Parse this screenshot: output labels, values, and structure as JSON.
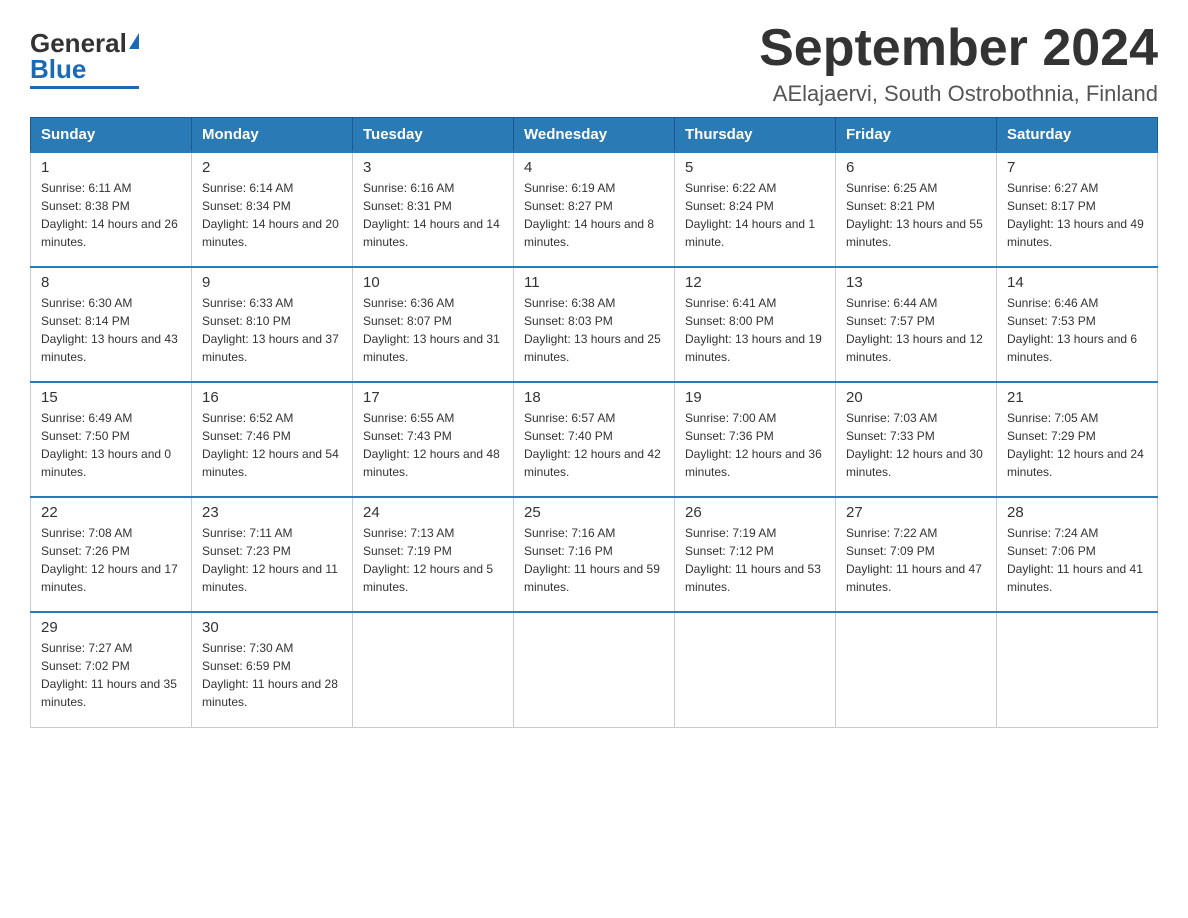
{
  "header": {
    "logo_general": "General",
    "logo_blue": "Blue",
    "month_title": "September 2024",
    "location": "AElajaervi, South Ostrobothnia, Finland"
  },
  "weekdays": [
    "Sunday",
    "Monday",
    "Tuesday",
    "Wednesday",
    "Thursday",
    "Friday",
    "Saturday"
  ],
  "weeks": [
    [
      {
        "day": "1",
        "sunrise": "Sunrise: 6:11 AM",
        "sunset": "Sunset: 8:38 PM",
        "daylight": "Daylight: 14 hours and 26 minutes."
      },
      {
        "day": "2",
        "sunrise": "Sunrise: 6:14 AM",
        "sunset": "Sunset: 8:34 PM",
        "daylight": "Daylight: 14 hours and 20 minutes."
      },
      {
        "day": "3",
        "sunrise": "Sunrise: 6:16 AM",
        "sunset": "Sunset: 8:31 PM",
        "daylight": "Daylight: 14 hours and 14 minutes."
      },
      {
        "day": "4",
        "sunrise": "Sunrise: 6:19 AM",
        "sunset": "Sunset: 8:27 PM",
        "daylight": "Daylight: 14 hours and 8 minutes."
      },
      {
        "day": "5",
        "sunrise": "Sunrise: 6:22 AM",
        "sunset": "Sunset: 8:24 PM",
        "daylight": "Daylight: 14 hours and 1 minute."
      },
      {
        "day": "6",
        "sunrise": "Sunrise: 6:25 AM",
        "sunset": "Sunset: 8:21 PM",
        "daylight": "Daylight: 13 hours and 55 minutes."
      },
      {
        "day": "7",
        "sunrise": "Sunrise: 6:27 AM",
        "sunset": "Sunset: 8:17 PM",
        "daylight": "Daylight: 13 hours and 49 minutes."
      }
    ],
    [
      {
        "day": "8",
        "sunrise": "Sunrise: 6:30 AM",
        "sunset": "Sunset: 8:14 PM",
        "daylight": "Daylight: 13 hours and 43 minutes."
      },
      {
        "day": "9",
        "sunrise": "Sunrise: 6:33 AM",
        "sunset": "Sunset: 8:10 PM",
        "daylight": "Daylight: 13 hours and 37 minutes."
      },
      {
        "day": "10",
        "sunrise": "Sunrise: 6:36 AM",
        "sunset": "Sunset: 8:07 PM",
        "daylight": "Daylight: 13 hours and 31 minutes."
      },
      {
        "day": "11",
        "sunrise": "Sunrise: 6:38 AM",
        "sunset": "Sunset: 8:03 PM",
        "daylight": "Daylight: 13 hours and 25 minutes."
      },
      {
        "day": "12",
        "sunrise": "Sunrise: 6:41 AM",
        "sunset": "Sunset: 8:00 PM",
        "daylight": "Daylight: 13 hours and 19 minutes."
      },
      {
        "day": "13",
        "sunrise": "Sunrise: 6:44 AM",
        "sunset": "Sunset: 7:57 PM",
        "daylight": "Daylight: 13 hours and 12 minutes."
      },
      {
        "day": "14",
        "sunrise": "Sunrise: 6:46 AM",
        "sunset": "Sunset: 7:53 PM",
        "daylight": "Daylight: 13 hours and 6 minutes."
      }
    ],
    [
      {
        "day": "15",
        "sunrise": "Sunrise: 6:49 AM",
        "sunset": "Sunset: 7:50 PM",
        "daylight": "Daylight: 13 hours and 0 minutes."
      },
      {
        "day": "16",
        "sunrise": "Sunrise: 6:52 AM",
        "sunset": "Sunset: 7:46 PM",
        "daylight": "Daylight: 12 hours and 54 minutes."
      },
      {
        "day": "17",
        "sunrise": "Sunrise: 6:55 AM",
        "sunset": "Sunset: 7:43 PM",
        "daylight": "Daylight: 12 hours and 48 minutes."
      },
      {
        "day": "18",
        "sunrise": "Sunrise: 6:57 AM",
        "sunset": "Sunset: 7:40 PM",
        "daylight": "Daylight: 12 hours and 42 minutes."
      },
      {
        "day": "19",
        "sunrise": "Sunrise: 7:00 AM",
        "sunset": "Sunset: 7:36 PM",
        "daylight": "Daylight: 12 hours and 36 minutes."
      },
      {
        "day": "20",
        "sunrise": "Sunrise: 7:03 AM",
        "sunset": "Sunset: 7:33 PM",
        "daylight": "Daylight: 12 hours and 30 minutes."
      },
      {
        "day": "21",
        "sunrise": "Sunrise: 7:05 AM",
        "sunset": "Sunset: 7:29 PM",
        "daylight": "Daylight: 12 hours and 24 minutes."
      }
    ],
    [
      {
        "day": "22",
        "sunrise": "Sunrise: 7:08 AM",
        "sunset": "Sunset: 7:26 PM",
        "daylight": "Daylight: 12 hours and 17 minutes."
      },
      {
        "day": "23",
        "sunrise": "Sunrise: 7:11 AM",
        "sunset": "Sunset: 7:23 PM",
        "daylight": "Daylight: 12 hours and 11 minutes."
      },
      {
        "day": "24",
        "sunrise": "Sunrise: 7:13 AM",
        "sunset": "Sunset: 7:19 PM",
        "daylight": "Daylight: 12 hours and 5 minutes."
      },
      {
        "day": "25",
        "sunrise": "Sunrise: 7:16 AM",
        "sunset": "Sunset: 7:16 PM",
        "daylight": "Daylight: 11 hours and 59 minutes."
      },
      {
        "day": "26",
        "sunrise": "Sunrise: 7:19 AM",
        "sunset": "Sunset: 7:12 PM",
        "daylight": "Daylight: 11 hours and 53 minutes."
      },
      {
        "day": "27",
        "sunrise": "Sunrise: 7:22 AM",
        "sunset": "Sunset: 7:09 PM",
        "daylight": "Daylight: 11 hours and 47 minutes."
      },
      {
        "day": "28",
        "sunrise": "Sunrise: 7:24 AM",
        "sunset": "Sunset: 7:06 PM",
        "daylight": "Daylight: 11 hours and 41 minutes."
      }
    ],
    [
      {
        "day": "29",
        "sunrise": "Sunrise: 7:27 AM",
        "sunset": "Sunset: 7:02 PM",
        "daylight": "Daylight: 11 hours and 35 minutes."
      },
      {
        "day": "30",
        "sunrise": "Sunrise: 7:30 AM",
        "sunset": "Sunset: 6:59 PM",
        "daylight": "Daylight: 11 hours and 28 minutes."
      },
      null,
      null,
      null,
      null,
      null
    ]
  ]
}
